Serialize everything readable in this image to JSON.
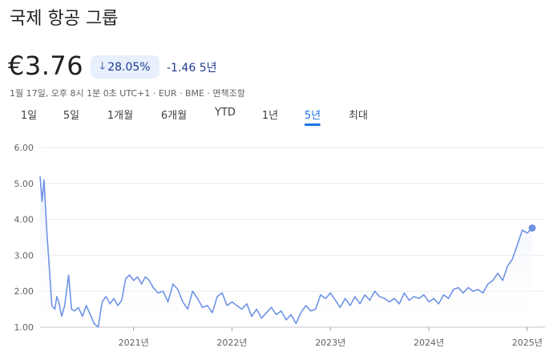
{
  "header": {
    "title": "국제 항공 그룹",
    "price": "€3.76",
    "change_pct": "28.05%",
    "change_abs": "-1.46",
    "change_period": "5년",
    "meta": "1월 17일, 오후 8시 1분 0초 UTC+1 · EUR · BME · 면책조항"
  },
  "tabs": [
    {
      "label": "1일",
      "active": false
    },
    {
      "label": "5일",
      "active": false
    },
    {
      "label": "1개월",
      "active": false
    },
    {
      "label": "6개월",
      "active": false
    },
    {
      "label": "YTD",
      "active": false
    },
    {
      "label": "1년",
      "active": false
    },
    {
      "label": "5년",
      "active": true
    },
    {
      "label": "최대",
      "active": false
    }
  ],
  "colors": {
    "line": "#6f93e6",
    "fill": "#e8effc",
    "accent": "#1a73e8",
    "badge_bg": "#e8f0fe"
  },
  "chart_data": {
    "type": "line",
    "title": "",
    "xlabel": "",
    "ylabel": "",
    "ylim": [
      1.0,
      6.0
    ],
    "yticks": [
      "1.00",
      "2.00",
      "3.00",
      "4.00",
      "5.00",
      "6.00"
    ],
    "xticks": [
      {
        "label": "2021년",
        "x": 2021.0
      },
      {
        "label": "2022년",
        "x": 2022.0
      },
      {
        "label": "2023년",
        "x": 2023.0
      },
      {
        "label": "2024년",
        "x": 2024.0
      },
      {
        "label": "2025년",
        "x": 2025.0
      }
    ],
    "grid": true,
    "series": [
      {
        "name": "",
        "x": [
          2020.05,
          2020.07,
          2020.09,
          2020.12,
          2020.14,
          2020.17,
          2020.2,
          2020.22,
          2020.24,
          2020.27,
          2020.3,
          2020.34,
          2020.37,
          2020.4,
          2020.44,
          2020.48,
          2020.52,
          2020.56,
          2020.6,
          2020.64,
          2020.68,
          2020.72,
          2020.76,
          2020.8,
          2020.84,
          2020.88,
          2020.92,
          2020.96,
          2021.0,
          2021.04,
          2021.08,
          2021.12,
          2021.16,
          2021.2,
          2021.25,
          2021.3,
          2021.35,
          2021.4,
          2021.45,
          2021.5,
          2021.55,
          2021.6,
          2021.65,
          2021.7,
          2021.75,
          2021.8,
          2021.85,
          2021.9,
          2021.95,
          2022.0,
          2022.05,
          2022.1,
          2022.15,
          2022.2,
          2022.25,
          2022.3,
          2022.35,
          2022.4,
          2022.45,
          2022.5,
          2022.55,
          2022.6,
          2022.65,
          2022.7,
          2022.75,
          2022.8,
          2022.85,
          2022.9,
          2022.95,
          2023.0,
          2023.05,
          2023.1,
          2023.15,
          2023.2,
          2023.25,
          2023.3,
          2023.35,
          2023.4,
          2023.45,
          2023.5,
          2023.55,
          2023.6,
          2023.65,
          2023.7,
          2023.75,
          2023.8,
          2023.85,
          2023.9,
          2023.95,
          2024.0,
          2024.05,
          2024.1,
          2024.15,
          2024.2,
          2024.25,
          2024.3,
          2024.35,
          2024.4,
          2024.45,
          2024.5,
          2024.55,
          2024.6,
          2024.65,
          2024.7,
          2024.75,
          2024.8,
          2024.85,
          2024.9,
          2024.95,
          2025.0,
          2025.03,
          2025.05
        ],
        "values": [
          5.2,
          4.5,
          5.1,
          3.6,
          2.8,
          1.6,
          1.5,
          1.85,
          1.7,
          1.3,
          1.6,
          2.45,
          1.5,
          1.45,
          1.55,
          1.3,
          1.6,
          1.35,
          1.1,
          1.0,
          1.7,
          1.85,
          1.65,
          1.8,
          1.6,
          1.75,
          2.35,
          2.45,
          2.3,
          2.4,
          2.2,
          2.4,
          2.3,
          2.1,
          1.95,
          2.0,
          1.7,
          2.2,
          2.05,
          1.7,
          1.5,
          2.0,
          1.8,
          1.55,
          1.6,
          1.4,
          1.85,
          1.95,
          1.6,
          1.7,
          1.6,
          1.5,
          1.65,
          1.3,
          1.5,
          1.25,
          1.4,
          1.55,
          1.35,
          1.45,
          1.2,
          1.35,
          1.1,
          1.4,
          1.6,
          1.45,
          1.5,
          1.9,
          1.8,
          1.95,
          1.75,
          1.55,
          1.8,
          1.6,
          1.85,
          1.65,
          1.9,
          1.75,
          2.0,
          1.85,
          1.8,
          1.7,
          1.8,
          1.65,
          1.95,
          1.75,
          1.85,
          1.8,
          1.9,
          1.7,
          1.8,
          1.65,
          1.9,
          1.8,
          2.05,
          2.1,
          1.95,
          2.1,
          2.0,
          2.05,
          1.95,
          2.2,
          2.3,
          2.5,
          2.3,
          2.7,
          2.9,
          3.3,
          3.7,
          3.62,
          3.7,
          3.76
        ]
      }
    ]
  }
}
